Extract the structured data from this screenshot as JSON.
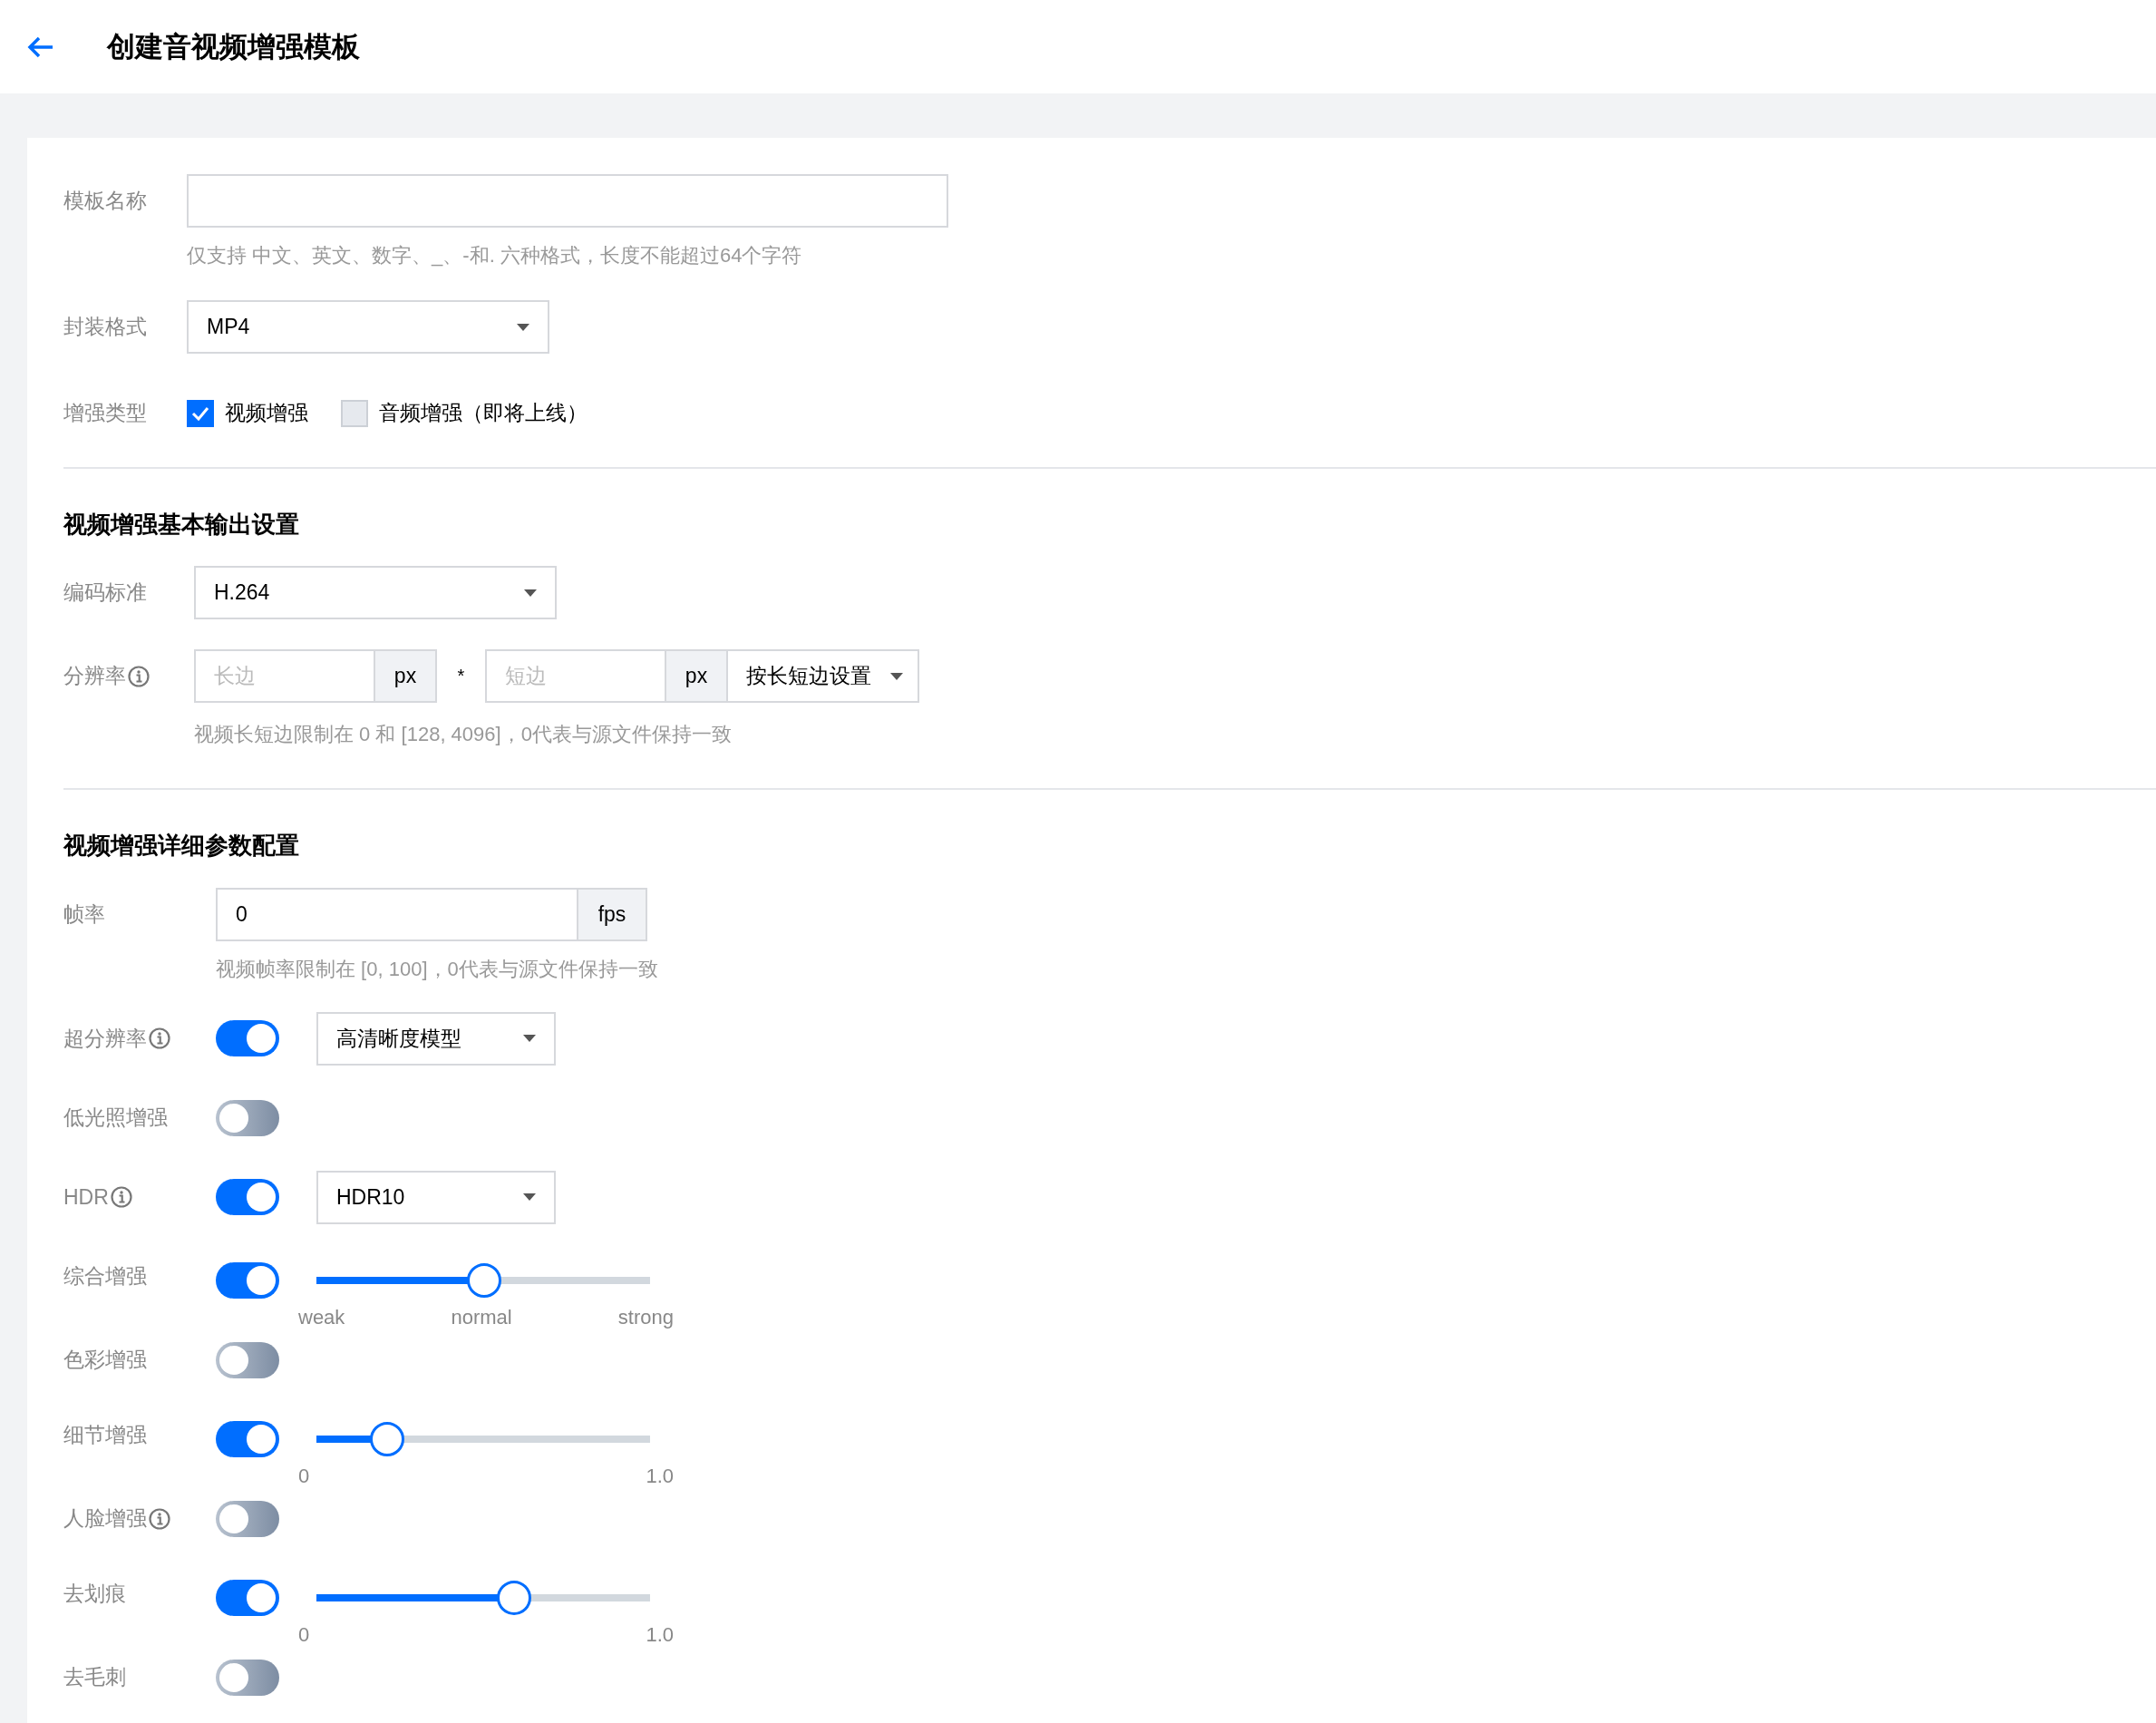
{
  "header": {
    "title": "创建音视频增强模板"
  },
  "basic": {
    "name_field": {
      "label": "模板名称",
      "hint": "仅支持 中文、英文、数字、_、-和. 六种格式，长度不能超过64个字符"
    },
    "container_format": {
      "label": "封装格式",
      "value": "MP4"
    },
    "enhance_type": {
      "label": "增强类型",
      "options": [
        {
          "label": "视频增强",
          "checked": true,
          "disabled": false
        },
        {
          "label": "音频增强（即将上线）",
          "checked": false,
          "disabled": true
        }
      ]
    }
  },
  "output_section": {
    "title": "视频增强基本输出设置",
    "codec": {
      "label": "编码标准",
      "value": "H.264"
    },
    "resolution": {
      "label": "分辨率",
      "info": true,
      "long_placeholder": "长边",
      "long_unit": "px",
      "separator": "*",
      "short_placeholder": "短边",
      "short_unit": "px",
      "mode": "按长短边设置",
      "hint": "视频长短边限制在 0 和 [128, 4096]，0代表与源文件保持一致"
    }
  },
  "detail_section": {
    "title": "视频增强详细参数配置",
    "frame_rate": {
      "label": "帧率",
      "value": "0",
      "unit": "fps",
      "hint": "视频帧率限制在 [0, 100]，0代表与源文件保持一致"
    },
    "options": [
      {
        "label": "超分辨率",
        "info": true,
        "on": true,
        "kind": "select",
        "value": "高清晰度模型"
      },
      {
        "label": "低光照增强",
        "info": false,
        "on": false,
        "kind": "toggle"
      },
      {
        "label": "HDR",
        "info": true,
        "on": true,
        "kind": "select",
        "value": "HDR10"
      },
      {
        "label": "综合增强",
        "info": false,
        "on": true,
        "kind": "slider",
        "level": 0.5,
        "ticks": [
          "weak",
          "normal",
          "strong"
        ]
      },
      {
        "label": "色彩增强",
        "info": false,
        "on": false,
        "kind": "toggle"
      },
      {
        "label": "细节增强",
        "info": false,
        "on": true,
        "kind": "slider",
        "level": 0.21,
        "ticks": [
          "0",
          "1.0"
        ]
      },
      {
        "label": "人脸增强",
        "info": true,
        "on": false,
        "kind": "toggle"
      },
      {
        "label": "去划痕",
        "info": false,
        "on": true,
        "kind": "slider",
        "level": 0.59,
        "ticks": [
          "0",
          "1.0"
        ]
      },
      {
        "label": "去毛刺",
        "info": false,
        "on": false,
        "kind": "toggle"
      }
    ]
  }
}
